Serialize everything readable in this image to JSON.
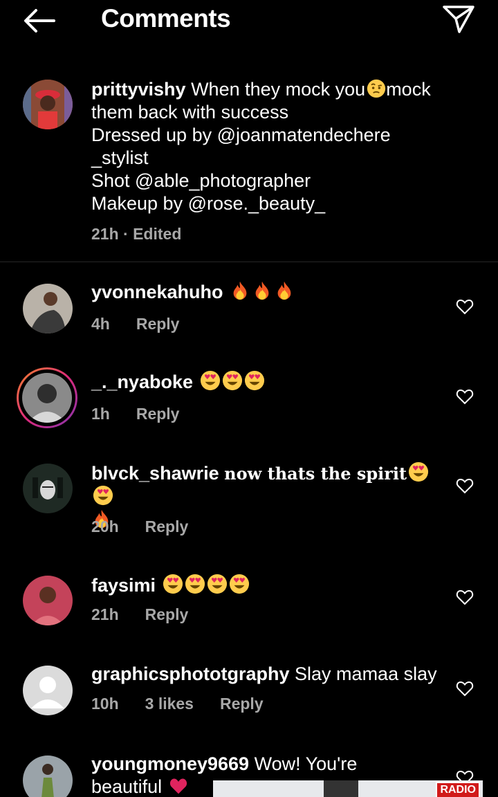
{
  "header": {
    "title": "Comments"
  },
  "caption": {
    "username": "prittyvishy",
    "line1_rest": "When they mock you",
    "line1_after": "mock",
    "lines": [
      "them back with success",
      "Dressed up by @joanmatendechere",
      "_stylist",
      "Shot @able_photographer",
      "Makeup by @rose._beauty_"
    ],
    "time": "21h",
    "edited": "Edited",
    "meta_sep": " · "
  },
  "comments": [
    {
      "username": "yvonnekahuho",
      "text": "",
      "time": "4h",
      "reply": "Reply",
      "emojis": "fire-fire-fire"
    },
    {
      "username": "_._nyaboke",
      "text": "",
      "time": "1h",
      "reply": "Reply",
      "emojis": "heart-eyes-x3"
    },
    {
      "username": "blvck_shawrie",
      "text": "now thats the spirit",
      "time": "20h",
      "reply": "Reply",
      "emojis": "heart-eyes-x2-fire"
    },
    {
      "username": "faysimi",
      "text": "",
      "time": "21h",
      "reply": "Reply",
      "emojis": "heart-eyes-x4"
    },
    {
      "username": "graphicsphototgraphy",
      "text": "Slay mamaa slay",
      "time": "10h",
      "likes": "3 likes",
      "reply": "Reply"
    },
    {
      "username": "youngmoney9669",
      "text": "Wow! You're",
      "text2": "beautiful",
      "emojis": "red-heart"
    }
  ],
  "ad": {
    "badge": "RADIO"
  },
  "colors": {
    "bg": "#000000",
    "text": "#ffffff",
    "meta": "#a8a8a8",
    "story_ring": "#d6249f"
  }
}
